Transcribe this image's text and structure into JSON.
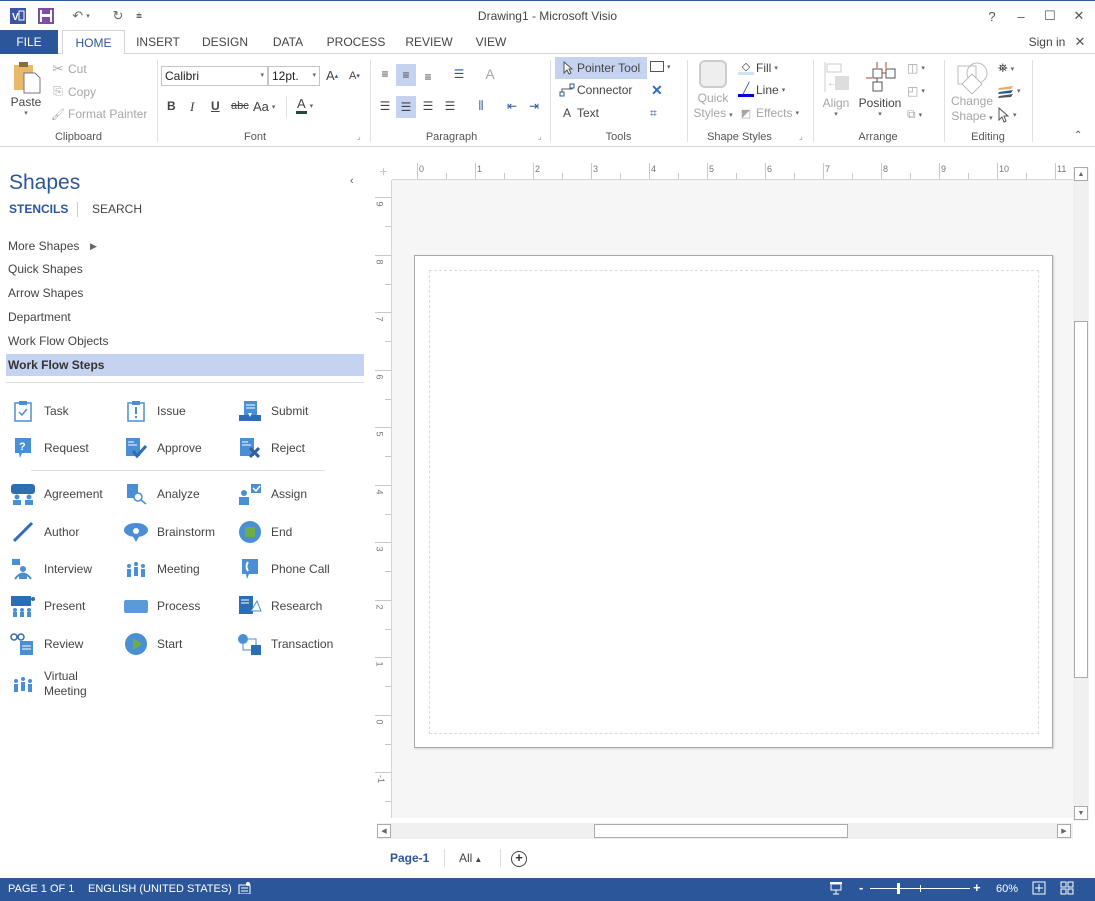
{
  "window": {
    "title": "Drawing1 - Microsoft Visio",
    "app_icon": "visio-logo-icon",
    "quick_access": [
      "save-icon",
      "undo-icon",
      "redo-icon",
      "customize-qat-icon"
    ],
    "controls": {
      "help": "?",
      "minimize": "–",
      "maximize": "☐",
      "close": "✕"
    }
  },
  "ribbon": {
    "tabs": [
      {
        "label": "FILE"
      },
      {
        "label": "HOME",
        "active": true
      },
      {
        "label": "INSERT"
      },
      {
        "label": "DESIGN"
      },
      {
        "label": "DATA"
      },
      {
        "label": "PROCESS"
      },
      {
        "label": "REVIEW"
      },
      {
        "label": "VIEW"
      }
    ],
    "sign_in": "Sign in",
    "groups": {
      "clipboard": {
        "label": "Clipboard",
        "paste": "Paste",
        "cut": "Cut",
        "copy": "Copy",
        "format_painter": "Format Painter"
      },
      "font": {
        "label": "Font",
        "font_name": "Calibri",
        "font_size": "12pt.",
        "bold": "B",
        "italic": "I",
        "underline": "U",
        "strike": "abc",
        "change_case": "Aa",
        "font_color": "A",
        "grow": "A",
        "shrink": "A"
      },
      "paragraph": {
        "label": "Paragraph"
      },
      "tools": {
        "label": "Tools",
        "pointer": "Pointer Tool",
        "connector": "Connector",
        "text": "Text"
      },
      "shape_styles": {
        "label": "Shape Styles",
        "quick_styles_1": "Quick",
        "quick_styles_2": "Styles",
        "fill": "Fill",
        "line": "Line",
        "effects": "Effects"
      },
      "arrange": {
        "label": "Arrange",
        "align": "Align",
        "position": "Position"
      },
      "editing": {
        "label": "Editing",
        "change_shape_1": "Change",
        "change_shape_2": "Shape"
      }
    }
  },
  "shapes_panel": {
    "title": "Shapes",
    "tabs": {
      "stencils": "STENCILS",
      "search": "SEARCH"
    },
    "stencils": [
      {
        "label": "More Shapes",
        "has_submenu": true
      },
      {
        "label": "Quick Shapes"
      },
      {
        "label": "Arrow Shapes"
      },
      {
        "label": "Department"
      },
      {
        "label": "Work Flow Objects"
      },
      {
        "label": "Work Flow Steps",
        "active": true
      }
    ],
    "shapes_group1": [
      {
        "label": "Task",
        "icon": "task-icon"
      },
      {
        "label": "Issue",
        "icon": "issue-icon"
      },
      {
        "label": "Submit",
        "icon": "submit-icon"
      },
      {
        "label": "Request",
        "icon": "request-icon"
      },
      {
        "label": "Approve",
        "icon": "approve-icon"
      },
      {
        "label": "Reject",
        "icon": "reject-icon"
      }
    ],
    "shapes_group2": [
      {
        "label": "Agreement",
        "icon": "agreement-icon"
      },
      {
        "label": "Analyze",
        "icon": "analyze-icon"
      },
      {
        "label": "Assign",
        "icon": "assign-icon"
      },
      {
        "label": "Author",
        "icon": "author-icon"
      },
      {
        "label": "Brainstorm",
        "icon": "brainstorm-icon"
      },
      {
        "label": "End",
        "icon": "end-icon"
      },
      {
        "label": "Interview",
        "icon": "interview-icon"
      },
      {
        "label": "Meeting",
        "icon": "meeting-icon"
      },
      {
        "label": "Phone Call",
        "icon": "phone-call-icon"
      },
      {
        "label": "Present",
        "icon": "present-icon"
      },
      {
        "label": "Process",
        "icon": "process-icon"
      },
      {
        "label": "Research",
        "icon": "research-icon"
      },
      {
        "label": "Review",
        "icon": "review-icon"
      },
      {
        "label": "Start",
        "icon": "start-icon"
      },
      {
        "label": "Transaction",
        "icon": "transaction-icon"
      },
      {
        "label": "Virtual Meeting",
        "label_line1": "Virtual",
        "label_line2": "Meeting",
        "icon": "virtual-meeting-icon"
      }
    ]
  },
  "canvas": {
    "ruler_h": [
      "0",
      "1",
      "2",
      "3",
      "4",
      "5",
      "6",
      "7",
      "8",
      "9",
      "10",
      "11"
    ],
    "ruler_v": [
      "9",
      "8",
      "7",
      "6",
      "5",
      "4",
      "3",
      "2",
      "1",
      "0",
      "-1"
    ],
    "page_tabs": {
      "current": "Page-1",
      "all": "All",
      "add": "+"
    }
  },
  "statusbar": {
    "page": "PAGE 1 OF 1",
    "language": "ENGLISH (UNITED STATES)",
    "zoom": "60%",
    "zoom_level_percent": 60
  },
  "colors": {
    "accent": "#2b579a",
    "selection": "#c5d3f0",
    "shape_blue": "#4a8fd3",
    "end_green": "#70ad47"
  }
}
